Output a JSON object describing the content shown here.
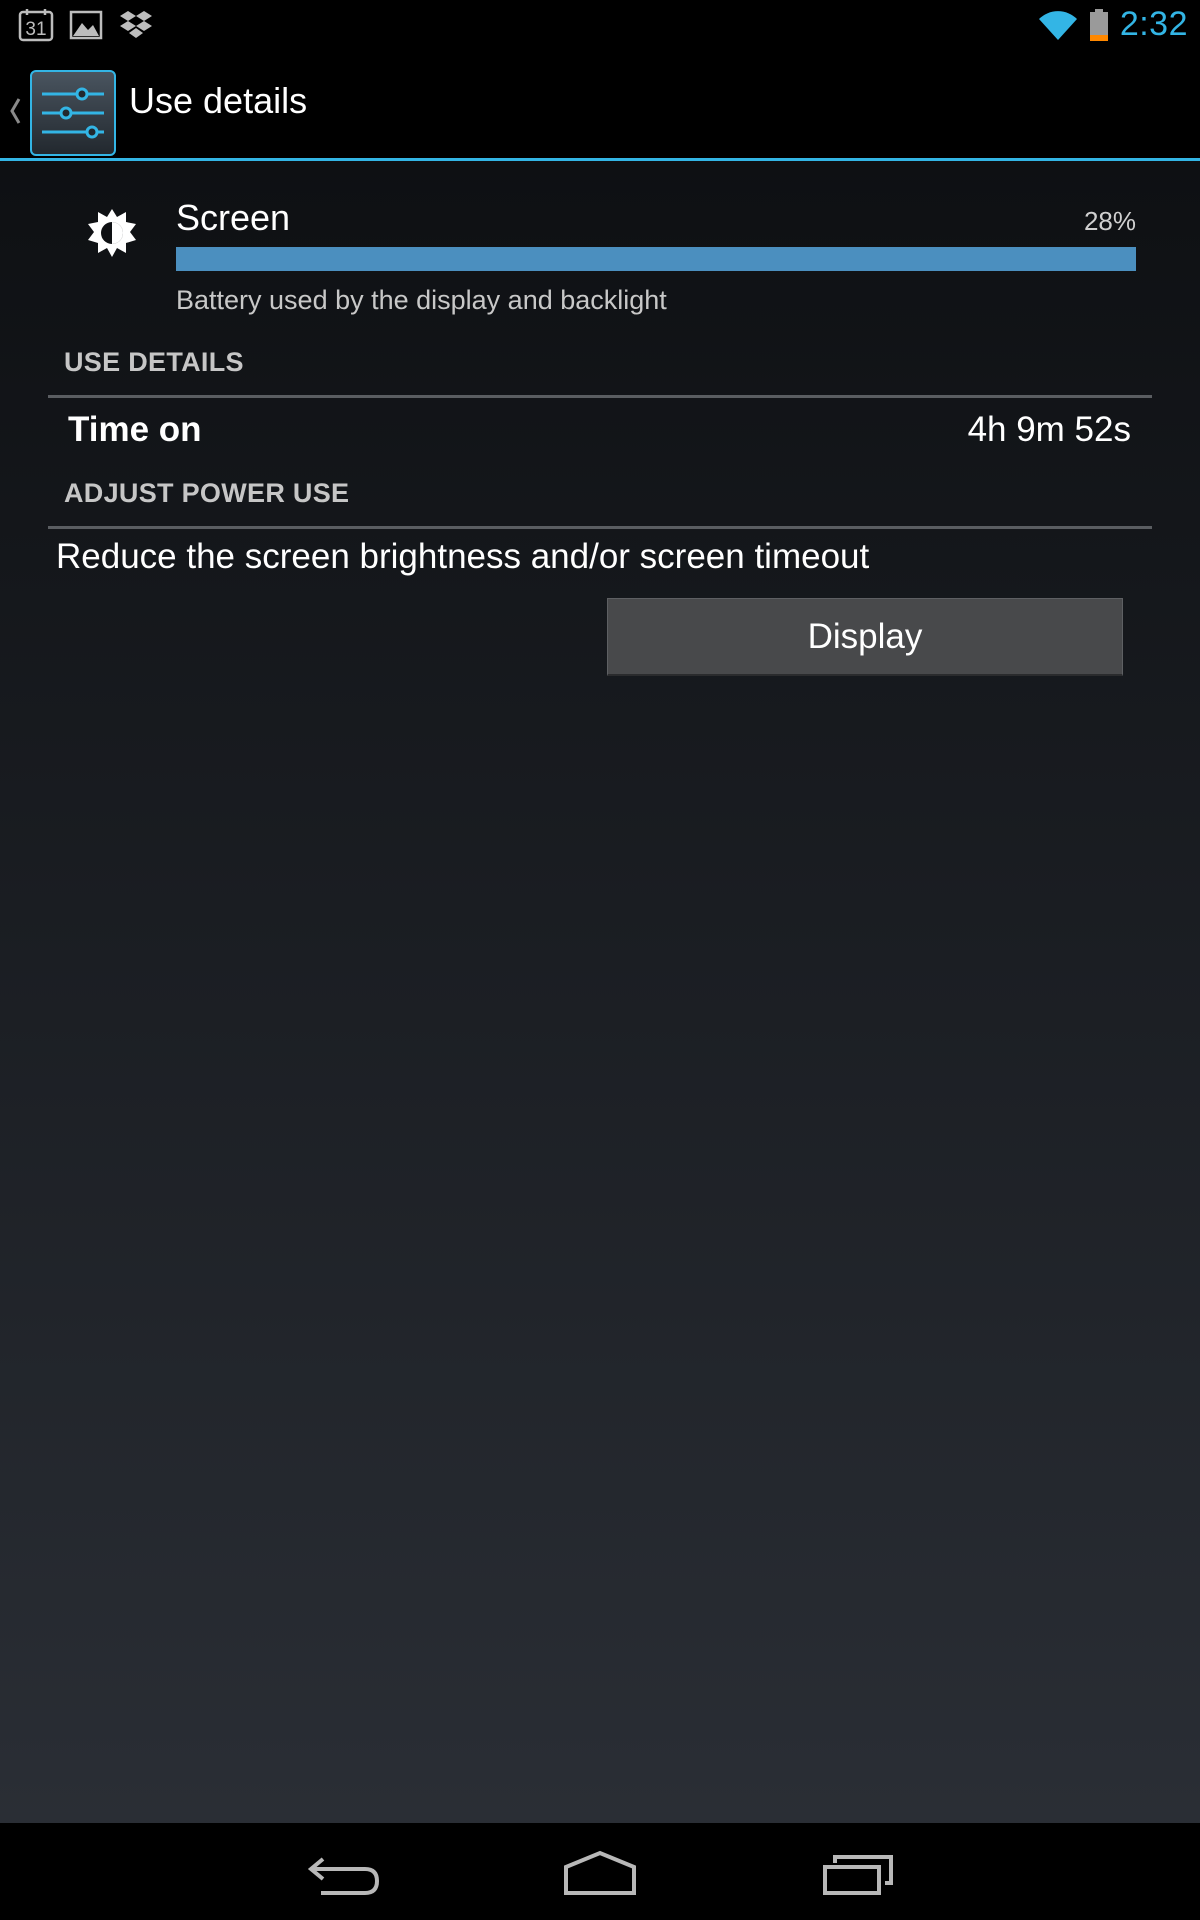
{
  "status_bar": {
    "time": "2:32",
    "calendar_day": "31",
    "icons": [
      "calendar-icon",
      "gallery-icon",
      "dropbox-icon",
      "wifi-icon",
      "battery-icon"
    ]
  },
  "action_bar": {
    "title": "Use details",
    "icon": "settings-sliders-icon"
  },
  "usage": {
    "icon": "brightness-icon",
    "title": "Screen",
    "percent": "28%",
    "bar_fill_percent": 100,
    "description": "Battery used by the display and backlight"
  },
  "sections": {
    "use_details": "USE DETAILS",
    "adjust_power": "ADJUST POWER USE"
  },
  "details": {
    "time_on_label": "Time on",
    "time_on_value": "4h 9m 52s"
  },
  "adjust": {
    "text": "Reduce the screen brightness and/or screen timeout",
    "button_label": "Display"
  },
  "nav_bar": {
    "icons": [
      "back-icon",
      "home-icon",
      "recents-icon"
    ]
  },
  "colors": {
    "accent": "#33b5e5",
    "bar": "#4b8fbf",
    "button": "#48494b"
  }
}
